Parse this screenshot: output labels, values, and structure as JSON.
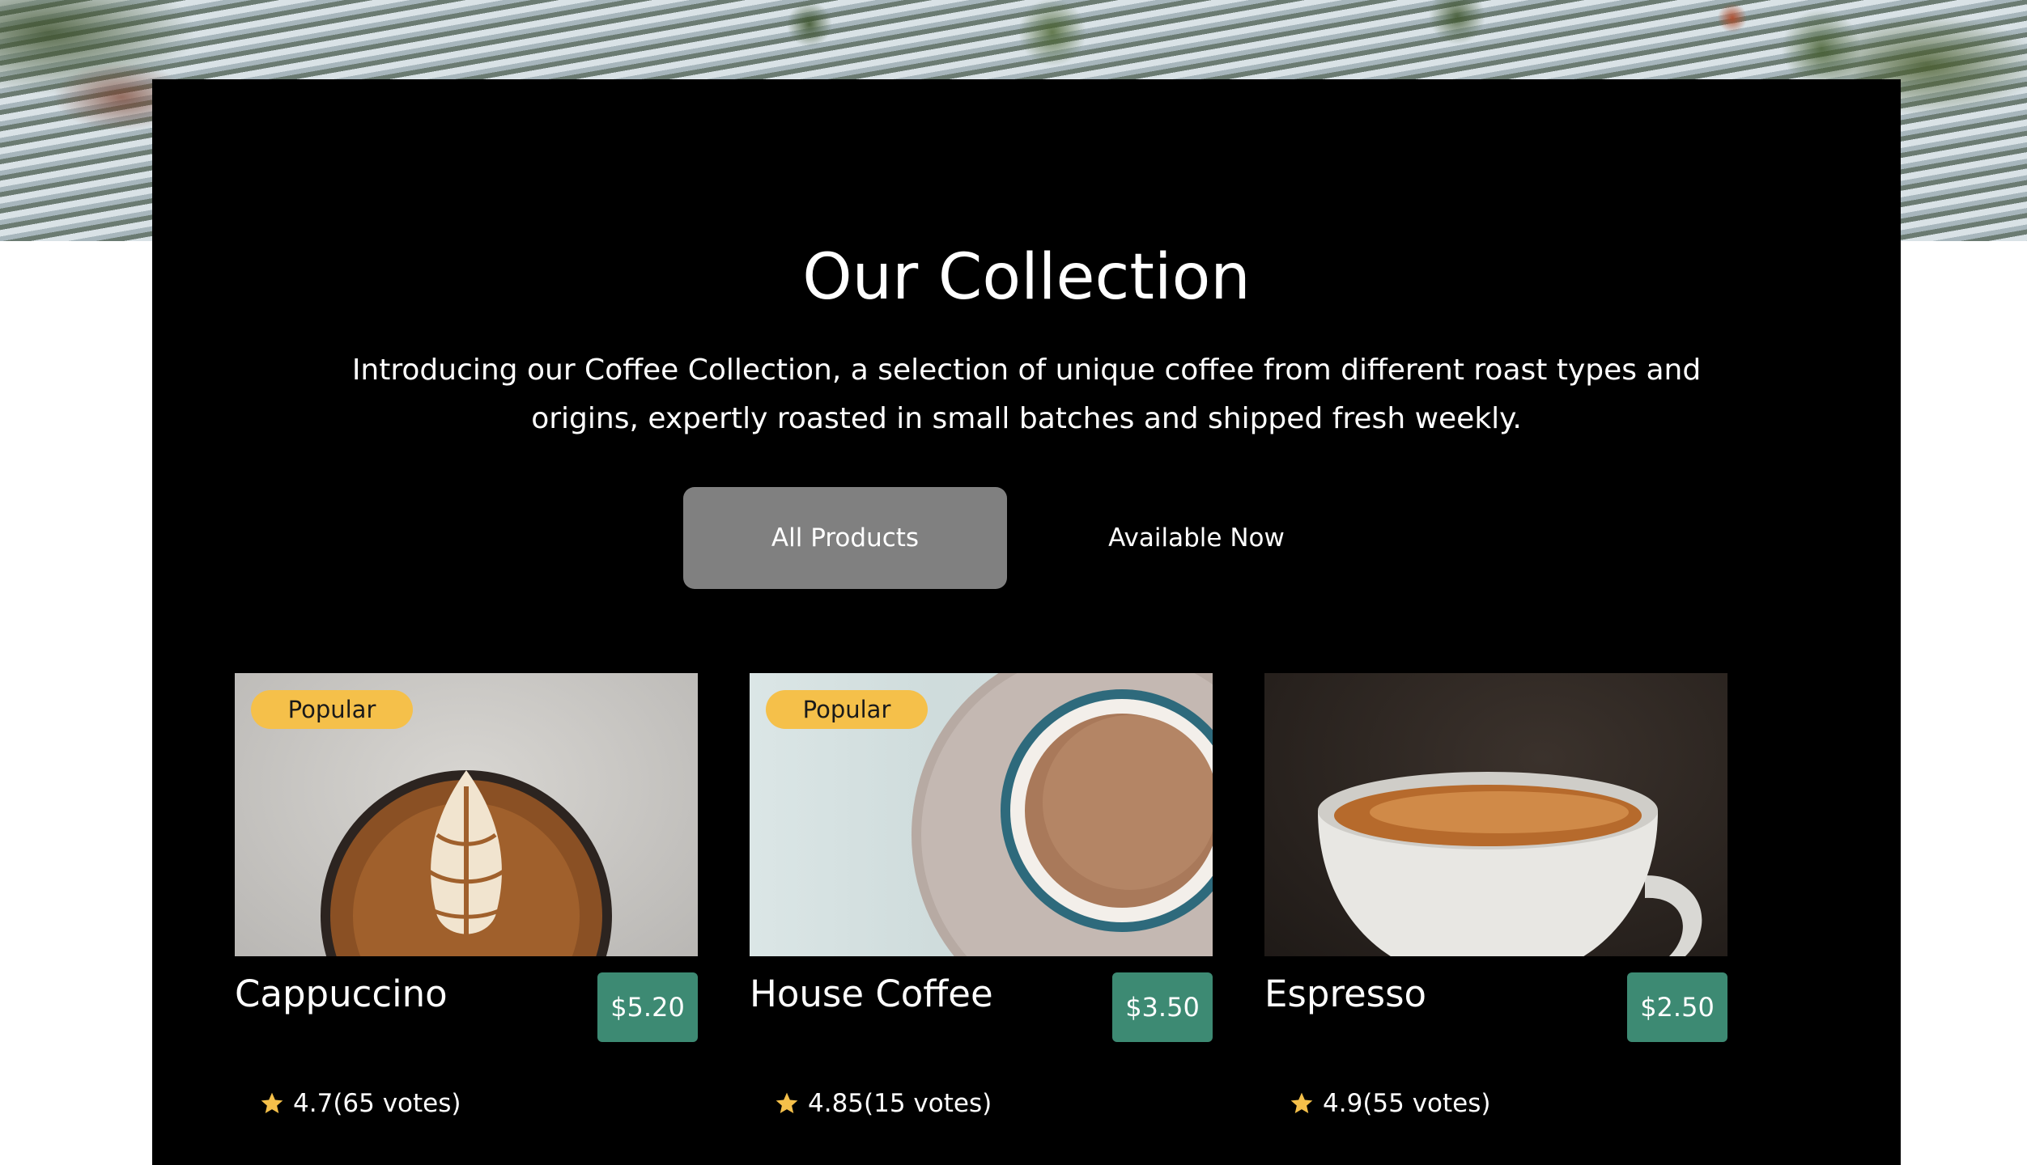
{
  "hero": {
    "image": "greenhouse-cafe-image"
  },
  "collection": {
    "title": "Our Collection",
    "intro": "Introducing our Coffee Collection, a selection of unique coffee from different roast types and origins, expertly roasted in small batches and shipped fresh weekly."
  },
  "tabs": [
    {
      "label": "All Products",
      "selected": true
    },
    {
      "label": "Available Now",
      "selected": false
    }
  ],
  "products": [
    {
      "name": "Cappuccino",
      "price": "$5.20",
      "badge": "Popular",
      "rating": "4.7",
      "votes": "(65 votes)",
      "image": "cappuccino-latte-art-image"
    },
    {
      "name": "House Coffee",
      "price": "$3.50",
      "badge": "Popular",
      "rating": "4.85",
      "votes": "(15 votes)",
      "image": "house-coffee-cup-image"
    },
    {
      "name": "Espresso",
      "price": "$2.50",
      "badge": "",
      "rating": "4.9",
      "votes": "(55 votes)",
      "image": "espresso-cup-image"
    }
  ],
  "colors": {
    "panel": "#000000",
    "badge": "#f5c04a",
    "price": "#3d8a73",
    "tab_selected": "#808080",
    "star": "#f5c04a"
  },
  "icons": {
    "rating": "star-icon"
  }
}
